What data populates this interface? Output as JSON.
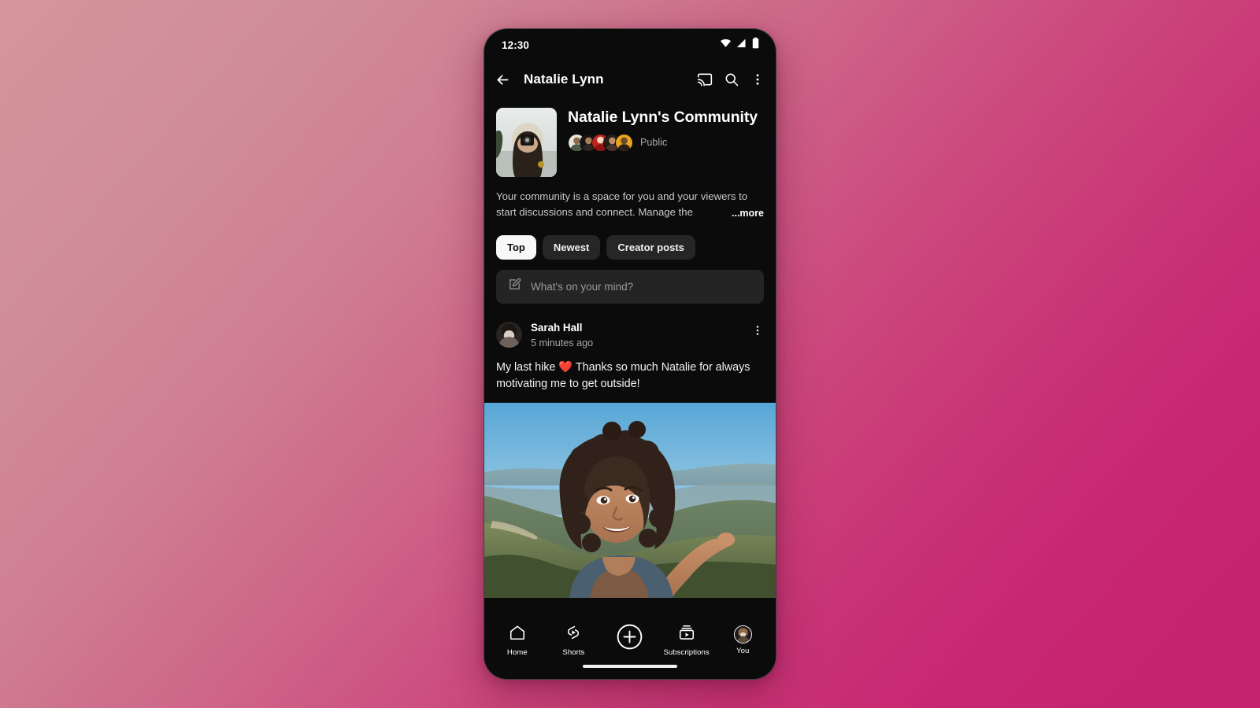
{
  "status_bar": {
    "time": "12:30",
    "icons": [
      "wifi-icon",
      "cellular-signal-icon",
      "battery-icon"
    ]
  },
  "app_bar": {
    "back_icon": "back-arrow-icon",
    "title": "Natalie Lynn",
    "cast_icon": "cast-icon",
    "search_icon": "search-icon",
    "overflow_icon": "more-vertical-icon"
  },
  "community": {
    "thumbnail_alt": "community-thumbnail",
    "title": "Natalie Lynn's Community",
    "visibility": "Public",
    "member_avatar_count": 5,
    "description": "Your community is a space for you and your viewers to start discussions and connect. Manage the",
    "more_label": "...more"
  },
  "filters": {
    "chips": [
      {
        "label": "Top",
        "active": true
      },
      {
        "label": "Newest",
        "active": false
      },
      {
        "label": "Creator posts",
        "active": false
      }
    ]
  },
  "composer": {
    "icon": "compose-pencil-icon",
    "placeholder": "What's on your mind?"
  },
  "post": {
    "author": "Sarah Hall",
    "timestamp": "5 minutes ago",
    "menu_icon": "more-vertical-icon",
    "body": "My last hike ❤️ Thanks so much Natalie for always motivating me to get outside!",
    "image_alt": "hiking-selfie-photo"
  },
  "bottom_nav": [
    {
      "label": "Home",
      "icon": "home-icon"
    },
    {
      "label": "Shorts",
      "icon": "shorts-icon"
    },
    {
      "label": "",
      "icon": "create-plus-icon"
    },
    {
      "label": "Subscriptions",
      "icon": "subscriptions-icon"
    },
    {
      "label": "You",
      "icon": "account-avatar-icon"
    }
  ],
  "colors": {
    "background_start": "#d4959c",
    "background_end": "#c62270",
    "surface": "#0b0b0b",
    "chip_inactive": "#262626",
    "chip_active": "#f8f8f8",
    "text_primary": "#ffffff",
    "text_secondary": "#aaaaaa"
  }
}
